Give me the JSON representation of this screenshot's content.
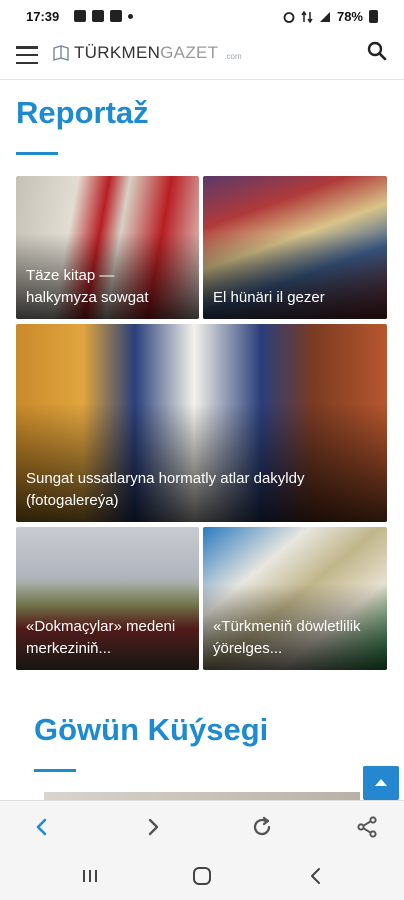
{
  "status_bar": {
    "time": "17:39",
    "battery": "78%"
  },
  "header": {
    "logo_main": "TÜRKMEN",
    "logo_light": "GAZET",
    "logo_domain": ".com"
  },
  "section_reportaz": {
    "title": "Reportaž"
  },
  "cards": [
    {
      "caption": "Täze kitap — halkymyza sowgat"
    },
    {
      "caption": "El hünäri il gezer"
    },
    {
      "caption": "Sungat ussatlaryna hormatly atlar dakyldy (fotogalereýa)"
    },
    {
      "caption": "«Dokmaçylar» medeni merkeziniň..."
    },
    {
      "caption": "«Türkmeniň döwletlilik ýörelges..."
    }
  ],
  "section_gowun": {
    "title": "Göwün Küýsegi"
  },
  "colors": {
    "accent": "#1e8bd1",
    "fab": "#2587cf",
    "browser_active": "#1e8bd1"
  },
  "icons": {
    "menu": "hamburger-icon",
    "search": "search-icon",
    "scroll_top": "arrow-up-icon",
    "back": "chevron-left-icon",
    "forward": "chevron-right-icon",
    "reload": "reload-icon",
    "share": "share-icon",
    "recents": "recents-icon",
    "home": "home-icon",
    "nav_back": "nav-back-icon"
  }
}
